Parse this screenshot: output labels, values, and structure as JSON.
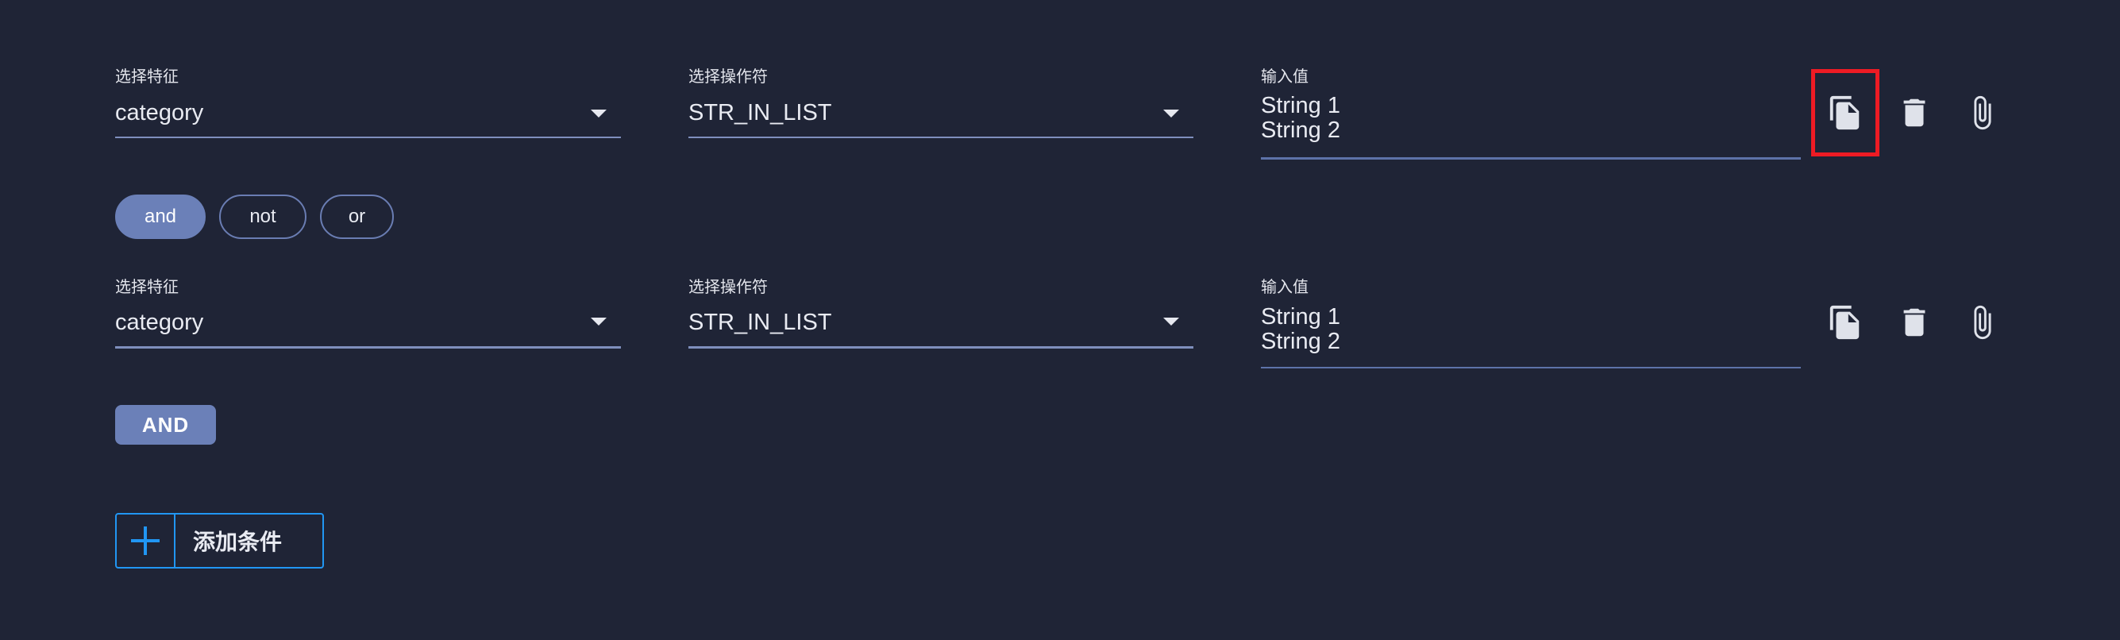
{
  "conditions": [
    {
      "feature_label": "选择特征",
      "feature_value": "category",
      "operator_label": "选择操作符",
      "operator_value": "STR_IN_LIST",
      "input_label": "输入值",
      "input_lines": [
        "String 1",
        "String 2"
      ],
      "copy_highlighted": true
    },
    {
      "feature_label": "选择特征",
      "feature_value": "category",
      "operator_label": "选择操作符",
      "operator_value": "STR_IN_LIST",
      "input_label": "输入值",
      "input_lines": [
        "String 1",
        "String 2"
      ],
      "copy_highlighted": false
    }
  ],
  "logic_toggle": {
    "options": [
      "and",
      "not",
      "or"
    ],
    "selected": "and"
  },
  "group_operator": "AND",
  "add_condition_label": "添加条件",
  "icons": {
    "copy": "copy-icon",
    "delete": "delete-icon",
    "attach": "paperclip-icon",
    "dropdown": "chevron-down-icon",
    "add": "plus-icon"
  },
  "colors": {
    "background": "#1f2436",
    "accent": "#6b80b8",
    "add_button_border": "#2196f3",
    "highlight": "#ee1b24"
  }
}
